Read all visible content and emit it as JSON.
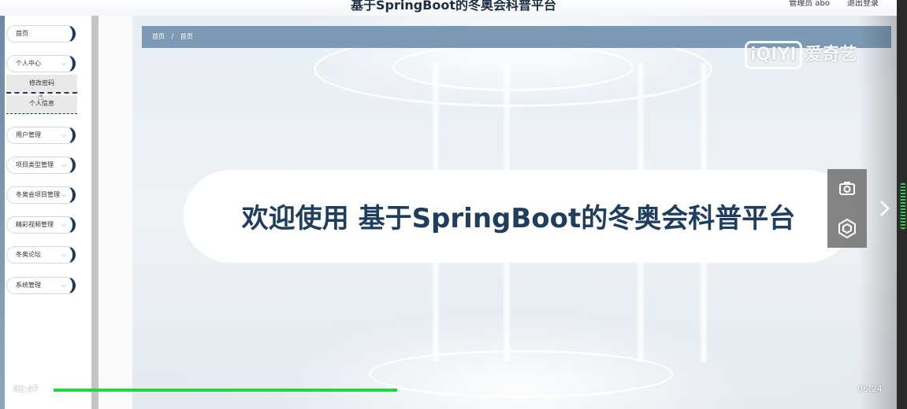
{
  "app": {
    "title": "基于SpringBoot的冬奥会科普平台",
    "user_label": "管理员 abo",
    "logout_label": "退出登录"
  },
  "breadcrumb": {
    "items": [
      "首页",
      "/",
      "首页"
    ]
  },
  "sidebar": {
    "items": [
      {
        "label": "首页",
        "has_chevron": false
      },
      {
        "label": "个人中心",
        "has_chevron": true
      },
      {
        "label": "用户管理",
        "has_chevron": true
      },
      {
        "label": "项目类型管理",
        "has_chevron": true
      },
      {
        "label": "冬奥会项目管理",
        "has_chevron": true
      },
      {
        "label": "精彩视频管理",
        "has_chevron": true
      },
      {
        "label": "冬奥论坛",
        "has_chevron": true
      },
      {
        "label": "系统管理",
        "has_chevron": true
      }
    ],
    "submenu": [
      "修改密码",
      "个人信息"
    ],
    "chevron_glyph": "⌵"
  },
  "main": {
    "welcome": "欢迎使用 基于SpringBoot的冬奥会科普平台"
  },
  "player": {
    "watermark_logo": "iQIYI",
    "watermark_brand": "爱奇艺",
    "time_current": "02:47",
    "time_total": "06:24",
    "progress_fraction": 0.435,
    "progress_color": "#23d53f",
    "tools": [
      "camera-icon",
      "screenshot-target-icon"
    ],
    "next_icon": "chevron-right-icon"
  },
  "colors": {
    "navy": "#1e3a5a",
    "breadcrumb_bg": "#7c9ab4",
    "welcome_text": "#1f3d5c"
  }
}
